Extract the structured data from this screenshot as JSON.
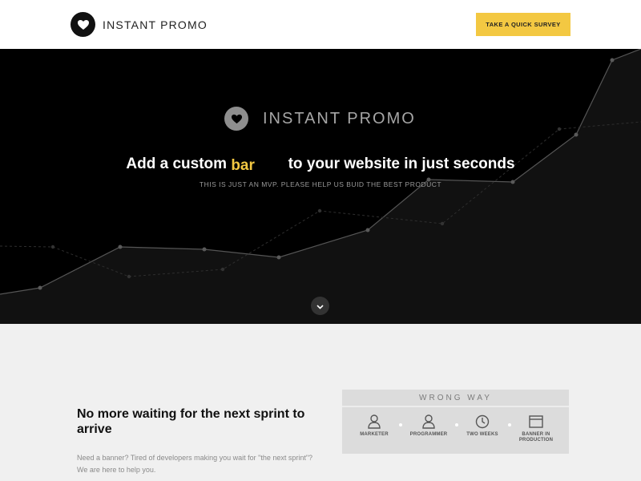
{
  "header": {
    "brand": "INSTANT PROMO",
    "survey_button": "TAKE A QUICK SURVEY"
  },
  "hero": {
    "brand": "INSTANT PROMO",
    "headline_before": "Add a custom",
    "headline_highlight": "bar",
    "headline_after": "to your website in just seconds",
    "subline": "THIS IS JUST AN MVP. PLEASE HELP US BUID THE BEST PRODUCT"
  },
  "lower": {
    "title": "No more waiting for the next sprint to arrive",
    "description": "Need a banner? Tired of developers making you wait for \"the next sprint\"? We are here to help you.",
    "wrong_way": {
      "heading": "WRONG WAY",
      "steps": [
        {
          "label": "MARKETER",
          "icon": "person-icon"
        },
        {
          "label": "PROGRAMMER",
          "icon": "person-icon"
        },
        {
          "label": "TWO WEEKS",
          "icon": "clock-icon"
        },
        {
          "label": "BANNER IN PRODUCTION",
          "icon": "browser-window-icon"
        }
      ]
    }
  },
  "colors": {
    "accent": "#f3c842",
    "hero_bg": "#000000",
    "section_bg": "#f0f0f0"
  },
  "icons": {
    "logo": "heart-icon",
    "scroll": "chevron-down-icon"
  }
}
